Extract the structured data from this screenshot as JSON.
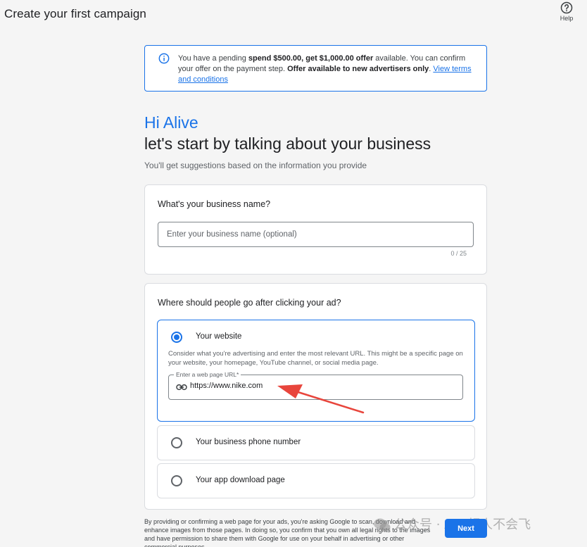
{
  "header": {
    "title": "Create your first campaign",
    "help_label": "Help"
  },
  "offer": {
    "text_1": "You have a pending ",
    "bold_1": "spend $500.00, get $1,000.00 offer",
    "text_2": " available. You can confirm your offer on the payment step. ",
    "bold_2": "Offer available to new advertisers only",
    "text_3": ". ",
    "link": "View terms and conditions"
  },
  "intro": {
    "greeting": "Hi Alive",
    "headline": "let's start by talking about your business",
    "subhead": "You'll get suggestions based on the information you provide"
  },
  "business_name": {
    "question": "What's your business name?",
    "placeholder": "Enter your business name (optional)",
    "counter": "0 / 25"
  },
  "destination": {
    "question": "Where should people go after clicking your ad?",
    "options": [
      {
        "label": "Your website",
        "selected": true,
        "description": "Consider what you're advertising and enter the most relevant URL. This might be a specific page on your website, your homepage, YouTube channel, or social media page.",
        "url_label": "Enter a web page URL*",
        "url_value": "https://www.nike.com"
      },
      {
        "label": "Your business phone number",
        "selected": false
      },
      {
        "label": "Your app download page",
        "selected": false
      }
    ]
  },
  "footer": {
    "disclaimer": "By providing or confirming a web page for your ads, you're asking Google to scan, download and enhance images from those pages. In doing so, you confirm that you own all legal rights to the images and have permission to share them with Google for use on your behalf in advertising or other commercial purposes.",
    "next_label": "Next"
  },
  "watermark": {
    "text": "公众号 · AFF超人不会飞"
  },
  "colors": {
    "accent": "#1a73e8",
    "arrow": "#e8453c"
  }
}
